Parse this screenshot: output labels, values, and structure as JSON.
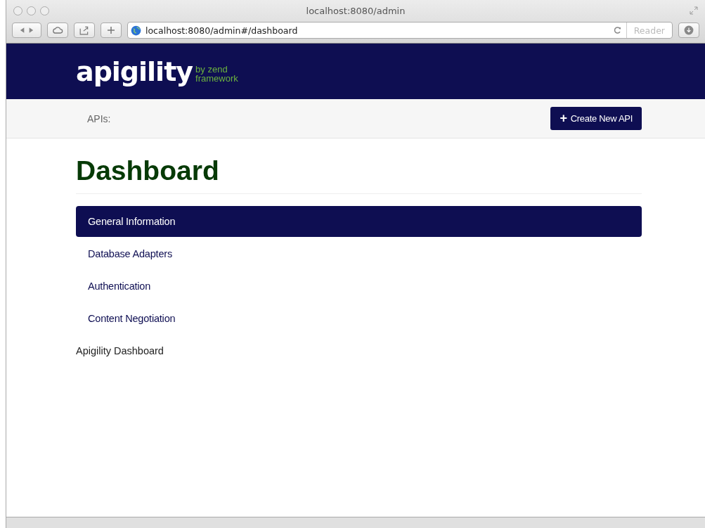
{
  "window": {
    "title": "localhost:8080/admin"
  },
  "toolbar": {
    "address": "localhost:8080/admin#/dashboard",
    "reader": "Reader"
  },
  "header": {
    "logo": "apigility",
    "tagline": [
      "by zend",
      "framework"
    ]
  },
  "subnav": {
    "label": "APIs:",
    "button": {
      "icon": "+",
      "label": "Create New API"
    }
  },
  "page": {
    "heading": "Dashboard",
    "nav": [
      {
        "label": "General Information",
        "selected": true
      },
      {
        "label": "Database Adapters",
        "selected": false
      },
      {
        "label": "Authentication",
        "selected": false
      },
      {
        "label": "Content Negotiation",
        "selected": false
      }
    ],
    "body": "Apigility Dashboard"
  }
}
